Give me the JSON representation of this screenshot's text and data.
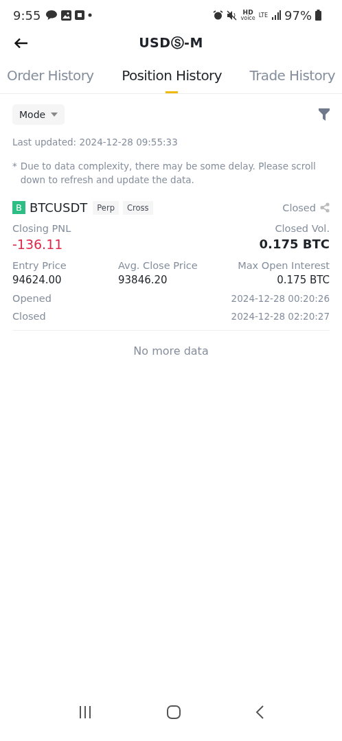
{
  "status_bar": {
    "time": "9:55",
    "hd": "HD",
    "voice": "voice",
    "lte": "LTE",
    "battery": "97%"
  },
  "header": {
    "title": "USDⓈ-M"
  },
  "tabs": [
    {
      "label": "Order History",
      "selected": false
    },
    {
      "label": "Position History",
      "selected": true
    },
    {
      "label": "Trade History",
      "selected": false
    }
  ],
  "filter": {
    "mode": "Mode"
  },
  "last_updated": "Last updated: 2024-12-28 09:55:33",
  "notice_mark": "*",
  "notice": "Due to data complexity, there may be some delay. Please scroll down to refresh and update the data.",
  "position": {
    "side": "B",
    "symbol": "BTCUSDT",
    "tags": [
      "Perp",
      "Cross"
    ],
    "status": "Closed",
    "pnl_label": "Closing PNL",
    "pnl": "-136.11",
    "vol_label": "Closed Vol.",
    "vol": "0.175 BTC",
    "stats": [
      {
        "label": "Entry Price",
        "value": "94624.00"
      },
      {
        "label": "Avg. Close Price",
        "value": "93846.20"
      },
      {
        "label": "Max Open Interest",
        "value": "0.175 BTC"
      }
    ],
    "times": [
      {
        "label": "Opened",
        "value": "2024-12-28 00:20:26"
      },
      {
        "label": "Closed",
        "value": "2024-12-28 02:20:27"
      }
    ]
  },
  "end_text": "No more data"
}
